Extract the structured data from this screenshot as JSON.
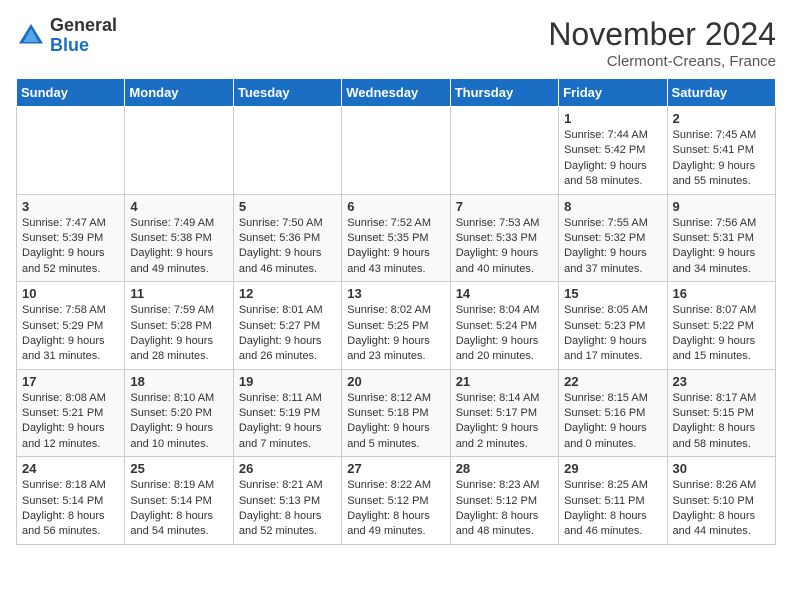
{
  "header": {
    "logo_general": "General",
    "logo_blue": "Blue",
    "month": "November 2024",
    "location": "Clermont-Creans, France"
  },
  "weekdays": [
    "Sunday",
    "Monday",
    "Tuesday",
    "Wednesday",
    "Thursday",
    "Friday",
    "Saturday"
  ],
  "weeks": [
    [
      {
        "day": "",
        "info": ""
      },
      {
        "day": "",
        "info": ""
      },
      {
        "day": "",
        "info": ""
      },
      {
        "day": "",
        "info": ""
      },
      {
        "day": "",
        "info": ""
      },
      {
        "day": "1",
        "info": "Sunrise: 7:44 AM\nSunset: 5:42 PM\nDaylight: 9 hours and 58 minutes."
      },
      {
        "day": "2",
        "info": "Sunrise: 7:45 AM\nSunset: 5:41 PM\nDaylight: 9 hours and 55 minutes."
      }
    ],
    [
      {
        "day": "3",
        "info": "Sunrise: 7:47 AM\nSunset: 5:39 PM\nDaylight: 9 hours and 52 minutes."
      },
      {
        "day": "4",
        "info": "Sunrise: 7:49 AM\nSunset: 5:38 PM\nDaylight: 9 hours and 49 minutes."
      },
      {
        "day": "5",
        "info": "Sunrise: 7:50 AM\nSunset: 5:36 PM\nDaylight: 9 hours and 46 minutes."
      },
      {
        "day": "6",
        "info": "Sunrise: 7:52 AM\nSunset: 5:35 PM\nDaylight: 9 hours and 43 minutes."
      },
      {
        "day": "7",
        "info": "Sunrise: 7:53 AM\nSunset: 5:33 PM\nDaylight: 9 hours and 40 minutes."
      },
      {
        "day": "8",
        "info": "Sunrise: 7:55 AM\nSunset: 5:32 PM\nDaylight: 9 hours and 37 minutes."
      },
      {
        "day": "9",
        "info": "Sunrise: 7:56 AM\nSunset: 5:31 PM\nDaylight: 9 hours and 34 minutes."
      }
    ],
    [
      {
        "day": "10",
        "info": "Sunrise: 7:58 AM\nSunset: 5:29 PM\nDaylight: 9 hours and 31 minutes."
      },
      {
        "day": "11",
        "info": "Sunrise: 7:59 AM\nSunset: 5:28 PM\nDaylight: 9 hours and 28 minutes."
      },
      {
        "day": "12",
        "info": "Sunrise: 8:01 AM\nSunset: 5:27 PM\nDaylight: 9 hours and 26 minutes."
      },
      {
        "day": "13",
        "info": "Sunrise: 8:02 AM\nSunset: 5:25 PM\nDaylight: 9 hours and 23 minutes."
      },
      {
        "day": "14",
        "info": "Sunrise: 8:04 AM\nSunset: 5:24 PM\nDaylight: 9 hours and 20 minutes."
      },
      {
        "day": "15",
        "info": "Sunrise: 8:05 AM\nSunset: 5:23 PM\nDaylight: 9 hours and 17 minutes."
      },
      {
        "day": "16",
        "info": "Sunrise: 8:07 AM\nSunset: 5:22 PM\nDaylight: 9 hours and 15 minutes."
      }
    ],
    [
      {
        "day": "17",
        "info": "Sunrise: 8:08 AM\nSunset: 5:21 PM\nDaylight: 9 hours and 12 minutes."
      },
      {
        "day": "18",
        "info": "Sunrise: 8:10 AM\nSunset: 5:20 PM\nDaylight: 9 hours and 10 minutes."
      },
      {
        "day": "19",
        "info": "Sunrise: 8:11 AM\nSunset: 5:19 PM\nDaylight: 9 hours and 7 minutes."
      },
      {
        "day": "20",
        "info": "Sunrise: 8:12 AM\nSunset: 5:18 PM\nDaylight: 9 hours and 5 minutes."
      },
      {
        "day": "21",
        "info": "Sunrise: 8:14 AM\nSunset: 5:17 PM\nDaylight: 9 hours and 2 minutes."
      },
      {
        "day": "22",
        "info": "Sunrise: 8:15 AM\nSunset: 5:16 PM\nDaylight: 9 hours and 0 minutes."
      },
      {
        "day": "23",
        "info": "Sunrise: 8:17 AM\nSunset: 5:15 PM\nDaylight: 8 hours and 58 minutes."
      }
    ],
    [
      {
        "day": "24",
        "info": "Sunrise: 8:18 AM\nSunset: 5:14 PM\nDaylight: 8 hours and 56 minutes."
      },
      {
        "day": "25",
        "info": "Sunrise: 8:19 AM\nSunset: 5:14 PM\nDaylight: 8 hours and 54 minutes."
      },
      {
        "day": "26",
        "info": "Sunrise: 8:21 AM\nSunset: 5:13 PM\nDaylight: 8 hours and 52 minutes."
      },
      {
        "day": "27",
        "info": "Sunrise: 8:22 AM\nSunset: 5:12 PM\nDaylight: 8 hours and 49 minutes."
      },
      {
        "day": "28",
        "info": "Sunrise: 8:23 AM\nSunset: 5:12 PM\nDaylight: 8 hours and 48 minutes."
      },
      {
        "day": "29",
        "info": "Sunrise: 8:25 AM\nSunset: 5:11 PM\nDaylight: 8 hours and 46 minutes."
      },
      {
        "day": "30",
        "info": "Sunrise: 8:26 AM\nSunset: 5:10 PM\nDaylight: 8 hours and 44 minutes."
      }
    ]
  ]
}
